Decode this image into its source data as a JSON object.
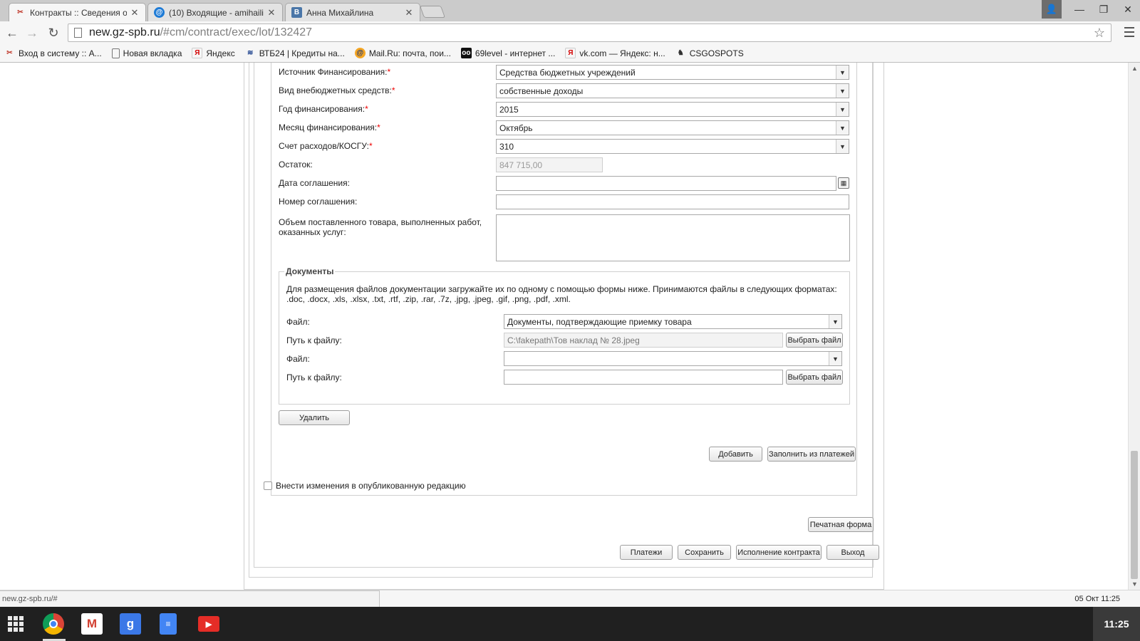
{
  "browser": {
    "tabs": [
      {
        "title": "Контракты :: Сведения о",
        "icon": "gz-icon"
      },
      {
        "title": "(10) Входящие - amihailina",
        "icon": "mail-at-icon"
      },
      {
        "title": "Анна Михайлина",
        "icon": "vk-icon"
      }
    ],
    "url_host": "new.gz-spb.ru",
    "url_path": "/#cm/contract/exec/lot/132427",
    "bookmarks": [
      {
        "label": "Вход в систему :: А...",
        "icon": "gz-icon"
      },
      {
        "label": "Новая вкладка",
        "icon": "page-icon"
      },
      {
        "label": "Яндекс",
        "icon": "yandex-icon"
      },
      {
        "label": "ВТБ24 | Кредиты на...",
        "icon": "vtb-icon"
      },
      {
        "label": "Mail.Ru: почта, пои...",
        "icon": "mailru-icon"
      },
      {
        "label": "69level - интернет ...",
        "icon": "69level-icon"
      },
      {
        "label": "vk.com — Яндекс: н...",
        "icon": "yandex-icon"
      },
      {
        "label": "CSGOSPOTS",
        "icon": "csgo-icon"
      }
    ]
  },
  "form": {
    "funding_source": {
      "label": "Источник Финансирования:",
      "value": "Средства бюджетных учреждений"
    },
    "extrabudget_type": {
      "label": "Вид внебюджетных средств:",
      "value": "собственные доходы"
    },
    "funding_year": {
      "label": "Год финансирования:",
      "value": "2015"
    },
    "funding_month": {
      "label": "Месяц финансирования:",
      "value": "Октябрь"
    },
    "expense_account": {
      "label": "Счет расходов/КОСГУ:",
      "value": "310"
    },
    "remainder": {
      "label": "Остаток:",
      "value": "847 715,00"
    },
    "agreement_date": {
      "label": "Дата соглашения:",
      "value": ""
    },
    "agreement_number": {
      "label": "Номер соглашения:",
      "value": ""
    },
    "volume": {
      "label_line1": "Объем поставленного товара, выполненных работ,",
      "label_line2": "оказанных услуг:",
      "value": ""
    },
    "required_mark": "*"
  },
  "documents": {
    "legend": "Документы",
    "info_line1": "Для размещения файлов документации загружайте их по одному с помощью формы ниже. Принимаются файлы в следующих форматах:",
    "info_line2": ".doc, .docx, .xls, .xlsx, .txt, .rtf, .zip, .rar, .7z, .jpg, .jpeg, .gif, .png, .pdf, .xml.",
    "file_label": "Файл:",
    "path_label": "Путь к файлу:",
    "choose_label": "Выбрать файл",
    "rows": [
      {
        "file": "Документы, подтверждающие приемку товара",
        "path": "C:\\fakepath\\Тов наклад № 28.jpeg"
      },
      {
        "file": "",
        "path": ""
      }
    ]
  },
  "buttons": {
    "delete": "Удалить",
    "add": "Добавить",
    "fill_from_payments": "Заполнить из платежей",
    "print_form": "Печатная форма",
    "payments": "Платежи",
    "save": "Сохранить",
    "contract_execution": "Исполнение контракта",
    "exit": "Выход"
  },
  "publish_changes": {
    "label": "Внести изменения в опубликованную редакцию",
    "checked": false
  },
  "status": {
    "url": "new.gz-spb.ru/#",
    "date": "05 Окт 11:25"
  },
  "shelf": {
    "time": "11:25",
    "apps": [
      "chrome-icon",
      "gmail-icon",
      "google-search-icon",
      "docs-icon",
      "youtube-icon"
    ]
  }
}
